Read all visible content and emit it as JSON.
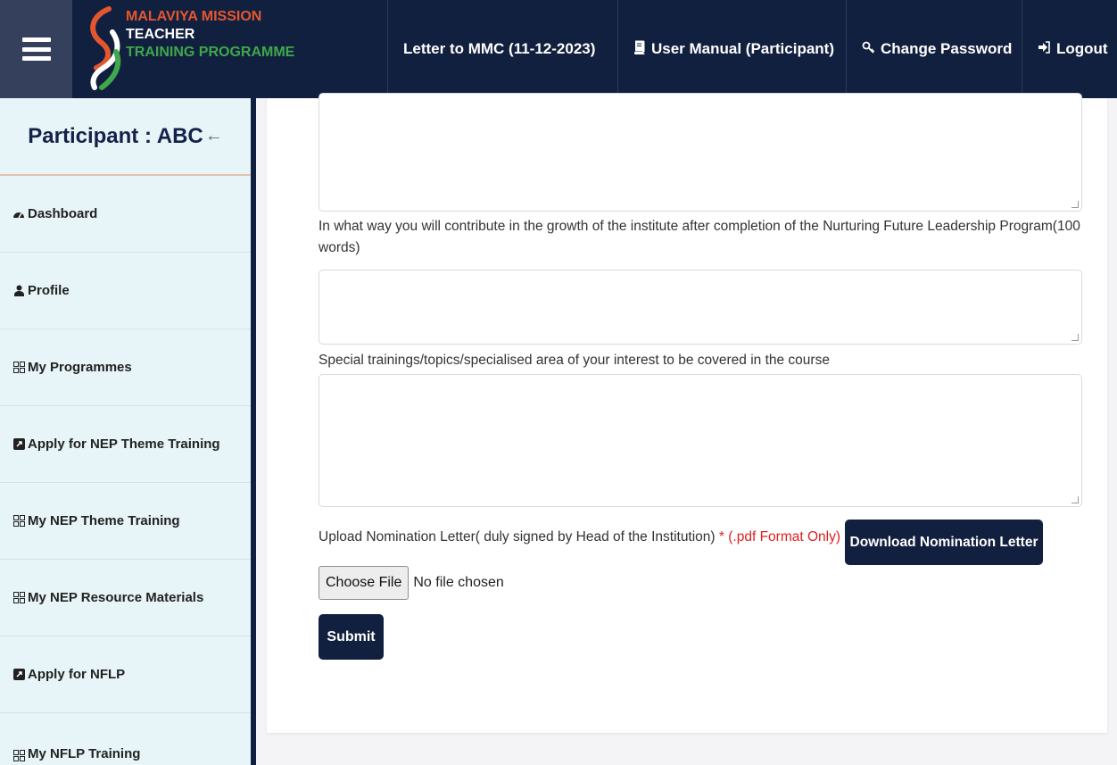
{
  "header": {
    "logo": {
      "line1": "MALAVIYA MISSION",
      "line2": "TEACHER",
      "line3": "TRAINING PROGRAMME",
      "colors": {
        "red": "#e4572e",
        "white": "#ffffff",
        "green": "#3ea84a"
      }
    },
    "nav": {
      "letter": "Letter to MMC (11-12-2023)",
      "manual": "User Manual (Participant)",
      "password": "Change Password",
      "logout": "Logout"
    },
    "background": "#12203f"
  },
  "sidebar": {
    "title": "Participant : ABC",
    "back_arrow": "←",
    "items": [
      {
        "label": "Dashboard",
        "icon": "dashboard-icon"
      },
      {
        "label": "Profile",
        "icon": "user-icon"
      },
      {
        "label": "My Programmes",
        "icon": "grid-icon"
      },
      {
        "label": "Apply for NEP Theme Training",
        "icon": "external-link-icon"
      },
      {
        "label": "My NEP Theme Training",
        "icon": "grid-icon"
      },
      {
        "label": "My NEP Resource Materials",
        "icon": "grid-icon"
      },
      {
        "label": "Apply for NFLP",
        "icon": "external-link-icon"
      },
      {
        "label": "My NFLP Training",
        "icon": "grid-icon"
      }
    ]
  },
  "form": {
    "q_growth": "In what way you will contribute in the growth of the institute after completion of the Nurturing Future Leadership Program(100 words)",
    "q_special": "Special trainings/topics/specialised area of your interest to be covered in the course",
    "upload_label": "Upload Nomination Letter( duly signed by Head of the Institution)",
    "required_mark": "*",
    "format_note": "(.pdf Format Only)",
    "download_button": "Download Nomination Letter",
    "choose_file": "Choose File",
    "no_file": "No file chosen",
    "submit": "Submit"
  }
}
